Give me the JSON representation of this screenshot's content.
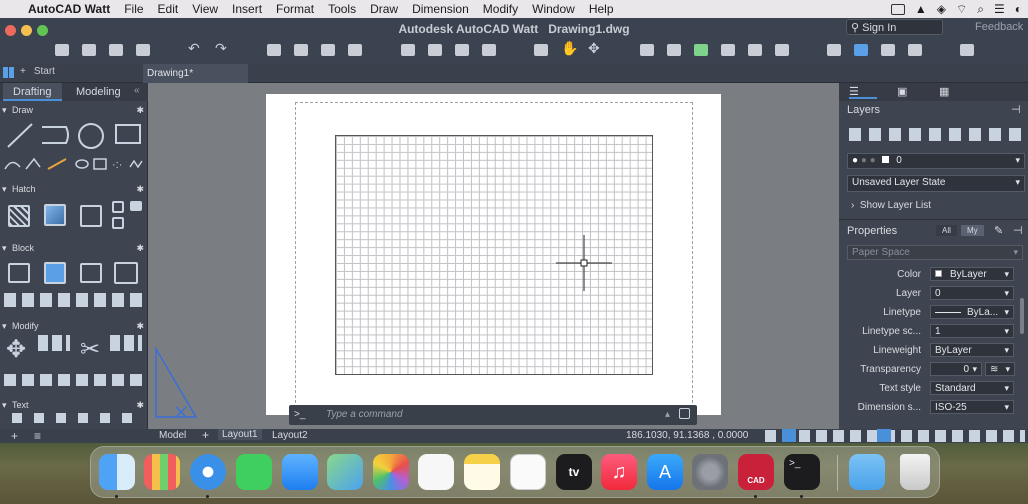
{
  "menubar": {
    "app_name": "AutoCAD Watt",
    "items": [
      "File",
      "Edit",
      "View",
      "Insert",
      "Format",
      "Tools",
      "Draw",
      "Dimension",
      "Modify",
      "Window",
      "Help"
    ]
  },
  "window": {
    "title": "Autodesk AutoCAD Watt",
    "filename": "Drawing1.dwg",
    "sign_in": "Sign In",
    "feedback": "Feedback"
  },
  "tabs": {
    "start": "Start",
    "drawing": "Drawing1*"
  },
  "left_panel": {
    "tabs": [
      "Drafting",
      "Modeling"
    ],
    "sections": [
      "Draw",
      "Hatch",
      "Block",
      "Modify",
      "Text"
    ]
  },
  "command": {
    "placeholder": "Type a command",
    "prompt": ">_"
  },
  "status": {
    "tabs": [
      "Model",
      "Layout1",
      "Layout2"
    ],
    "coords": "186.1030, 91.1368 , 0.0000"
  },
  "layers": {
    "title": "Layers",
    "current_layer": "0",
    "layer_state": "Unsaved Layer State",
    "show_list": "Show Layer List"
  },
  "properties": {
    "title": "Properties",
    "filter_all": "All",
    "filter_my": "My",
    "space": "Paper Space",
    "rows": [
      {
        "label": "Color",
        "value": "ByLayer"
      },
      {
        "label": "Layer",
        "value": "0"
      },
      {
        "label": "Linetype",
        "value": "ByLa..."
      },
      {
        "label": "Linetype sc...",
        "value": "1"
      },
      {
        "label": "Lineweight",
        "value": "ByLayer"
      },
      {
        "label": "Transparency",
        "value": "0"
      },
      {
        "label": "Text style",
        "value": "Standard"
      },
      {
        "label": "Dimension s...",
        "value": "ISO-25"
      }
    ]
  },
  "dock": {
    "apps": [
      "Finder",
      "Launchpad",
      "Safari",
      "Messages",
      "Mail",
      "Maps",
      "Photos",
      "Reminders",
      "Notes",
      "Freeform",
      "Apple TV",
      "Music",
      "App Store",
      "System Settings",
      "AutoCAD",
      "Terminal",
      "Downloads",
      "Trash"
    ],
    "cad_badge": "CAD",
    "tv_label": "tv"
  },
  "colors": {
    "accent": "#4a90d9",
    "panel": "#3f4550",
    "titlebar": "#3c4350"
  }
}
